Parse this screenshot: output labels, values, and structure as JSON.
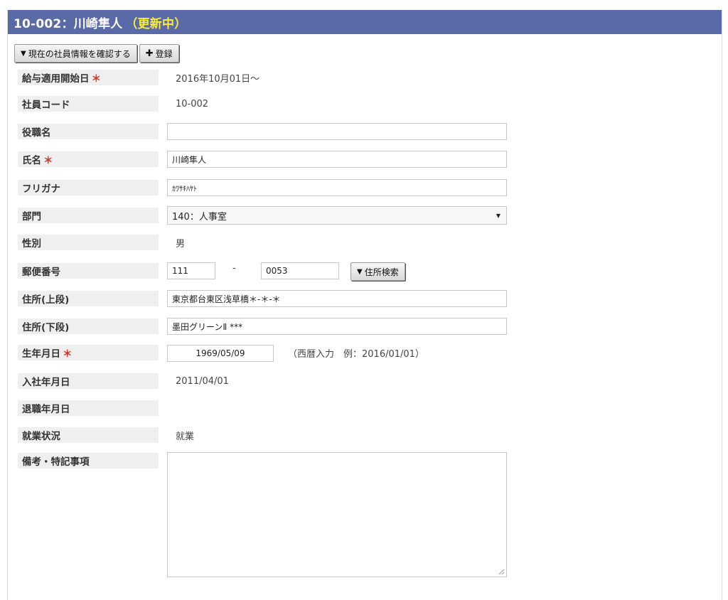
{
  "header": {
    "title": "10-002：川崎隼人",
    "status": "（更新中）"
  },
  "toolbar": {
    "confirm_label": "現在の社員情報を確認する",
    "register_label": "登録"
  },
  "form": {
    "start_date": {
      "label": "給与適用開始日",
      "required": true,
      "value": "2016年10月01日〜"
    },
    "employee_code": {
      "label": "社員コード",
      "value": "10-002"
    },
    "position": {
      "label": "役職名",
      "value": ""
    },
    "name": {
      "label": "氏名",
      "required": true,
      "value": "川崎隼人"
    },
    "furigana": {
      "label": "フリガナ",
      "value": "ｶﾜｻｷﾊﾔﾄ"
    },
    "department": {
      "label": "部門",
      "value": "140：人事室"
    },
    "gender": {
      "label": "性別",
      "value": "男"
    },
    "postal_code": {
      "label": "郵便番号",
      "part1": "111",
      "separator": "-",
      "part2": "0053",
      "search_label": "住所検索"
    },
    "address1": {
      "label": "住所(上段)",
      "value": "東京都台東区浅草橋＊-＊-＊"
    },
    "address2": {
      "label": "住所(下段)",
      "value": "墨田グリーンⅡ ***"
    },
    "birthdate": {
      "label": "生年月日",
      "required": true,
      "value": "1969/05/09",
      "hint": "（西暦入力　例：2016/01/01）"
    },
    "hire_date": {
      "label": "入社年月日",
      "value": "2011/04/01"
    },
    "retire_date": {
      "label": "退職年月日",
      "value": ""
    },
    "employment_status": {
      "label": "就業状況",
      "value": "就業"
    },
    "notes": {
      "label": "備考・特記事項",
      "value": ""
    }
  },
  "required_mark": "＊",
  "colors": {
    "header_bg": "#5a6aa6",
    "status_text": "#ffea3a",
    "required": "#d9302a",
    "label_bg": "#efefef"
  }
}
